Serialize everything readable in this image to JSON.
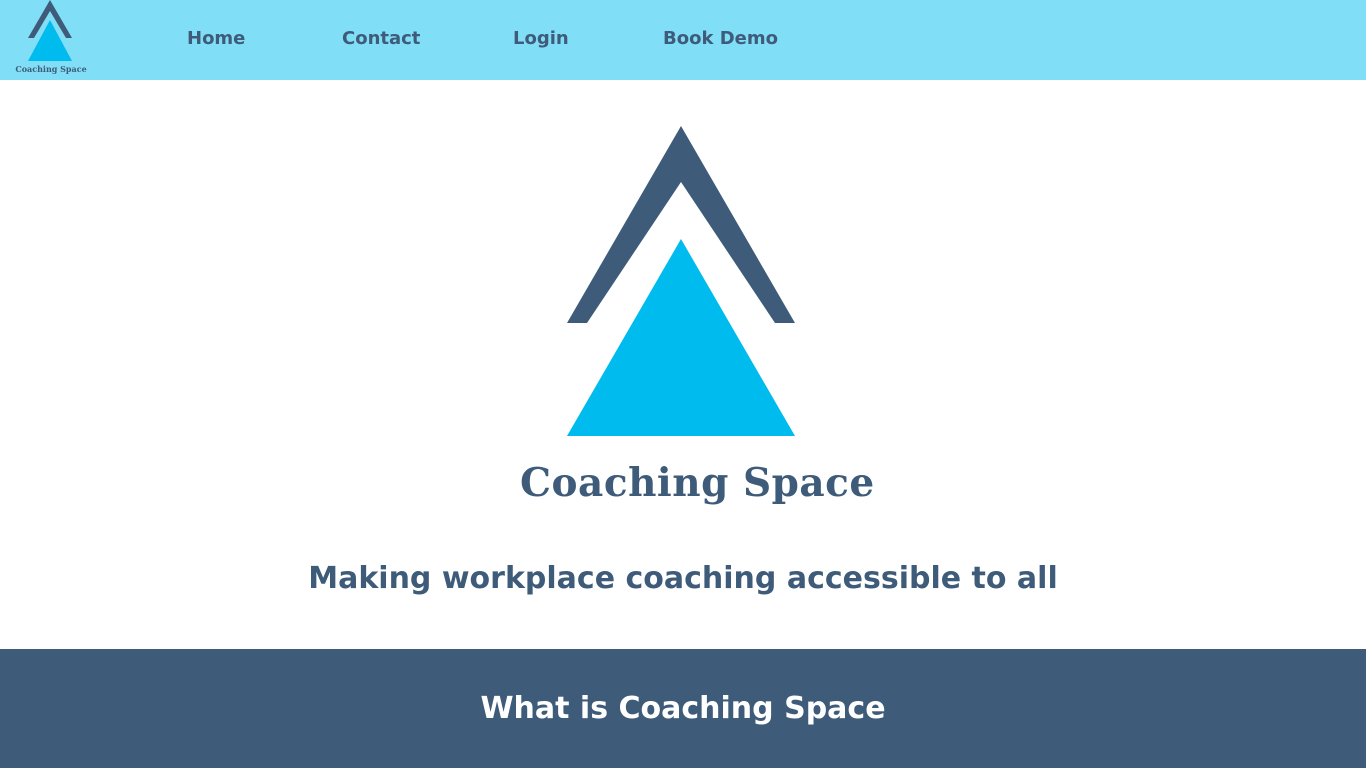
{
  "brand": {
    "name": "Coaching Space",
    "colors": {
      "navy": "#3e5c7a",
      "cyan": "#00bcee",
      "nav_bg": "#80def7"
    }
  },
  "nav": {
    "items": [
      {
        "label": "Home"
      },
      {
        "label": "Contact"
      },
      {
        "label": "Login"
      },
      {
        "label": "Book Demo"
      }
    ]
  },
  "hero": {
    "logo_text": "Coaching Space",
    "tagline": "Making workplace coaching accessible to all"
  },
  "section": {
    "title": "What is Coaching Space"
  }
}
